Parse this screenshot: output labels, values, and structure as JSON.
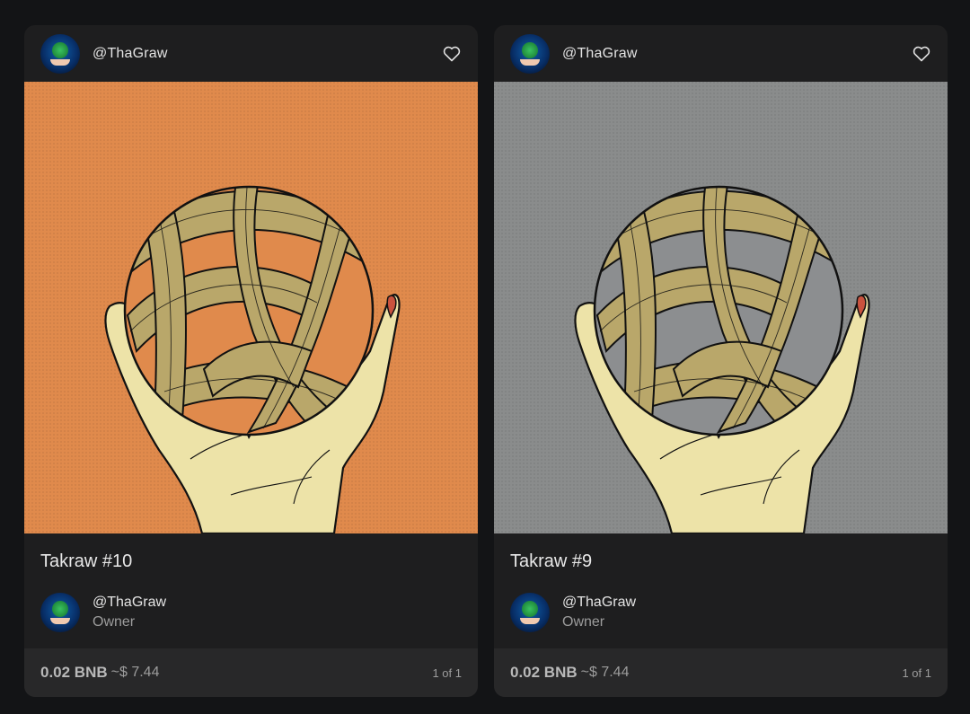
{
  "cards": [
    {
      "creator": "@ThaGraw",
      "title": "Takraw #10",
      "owner_name": "@ThaGraw",
      "owner_role": "Owner",
      "price": "0.02 BNB",
      "usd": "~$ 7.44",
      "edition": "1 of 1",
      "art": {
        "background": "#e08a4c",
        "gap_color": "#e08a4c"
      }
    },
    {
      "creator": "@ThaGraw",
      "title": "Takraw #9",
      "owner_name": "@ThaGraw",
      "owner_role": "Owner",
      "price": "0.02 BNB",
      "usd": "~$ 7.44",
      "edition": "1 of 1",
      "art": {
        "background": "#8a8c8c",
        "gap_color": "#8c8e90"
      }
    }
  ],
  "colors": {
    "page_bg": "#131416",
    "card_bg": "#1e1e1f",
    "footer_bg": "#282829",
    "rattan": "#b9a76a",
    "skin": "#ede3a8",
    "nail": "#c9523e"
  }
}
